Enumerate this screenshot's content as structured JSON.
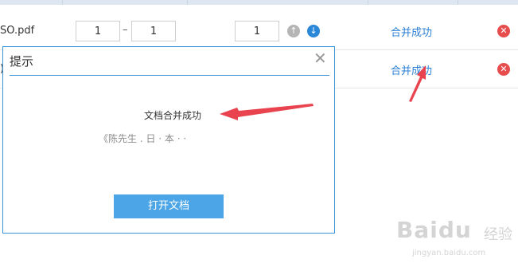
{
  "rows": [
    {
      "filename": "SO.pdf",
      "from": "1",
      "to": "1",
      "order": "1",
      "status": "合并成功"
    },
    {
      "filename": ")",
      "status": "合并成功"
    }
  ],
  "icons": {
    "up": "arrow-up-circle-icon",
    "down": "arrow-down-circle-icon",
    "delete": "delete-circle-icon",
    "close": "close-icon"
  },
  "dialog": {
    "title": "提示",
    "message": "文档合并成功",
    "doc_name": "《陈先生 . 日 · 本 · ·",
    "open_button": "打开文档"
  },
  "watermark": {
    "brand": "Baidu",
    "suffix": "经验",
    "url": "jingyan.baidu.com"
  },
  "colors": {
    "accent": "#3a92d6",
    "status": "#2a7fd4",
    "delete": "#e84d4d",
    "button": "#4ba5e6",
    "annotation": "#e8434f"
  }
}
